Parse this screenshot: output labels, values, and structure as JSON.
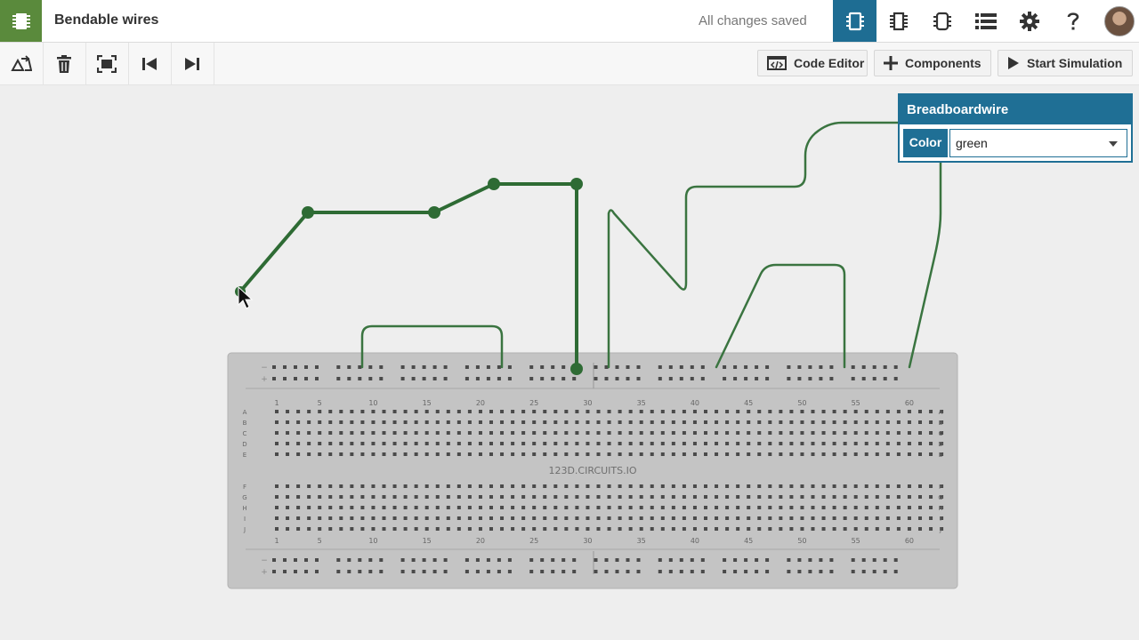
{
  "app": {
    "title": "Bendable wires",
    "status": "All changes saved"
  },
  "header_icons": [
    "breadboard-view-icon",
    "chip-icon",
    "component-icon",
    "list-icon",
    "gear-icon",
    "help-icon"
  ],
  "toolbar": {
    "code_editor": "Code Editor",
    "components": "Components",
    "start_simulation": "Start Simulation"
  },
  "inspector": {
    "title": "Breadboardwire",
    "color_label": "Color",
    "color_value": "green"
  },
  "breadboard": {
    "brand": "123D.CIRCUITS.IO",
    "column_labels": [
      "1",
      "5",
      "10",
      "15",
      "20",
      "25",
      "30",
      "35",
      "40",
      "45",
      "50",
      "55",
      "60"
    ],
    "row_labels_top": [
      "A",
      "B",
      "C",
      "D",
      "E"
    ],
    "row_labels_bottom": [
      "F",
      "G",
      "H",
      "I",
      "J"
    ],
    "rail_labels": [
      "−",
      "+"
    ]
  },
  "colors": {
    "wire": "#2e6b34",
    "accent": "#1f6f95",
    "brand_green": "#5a8a3c"
  }
}
